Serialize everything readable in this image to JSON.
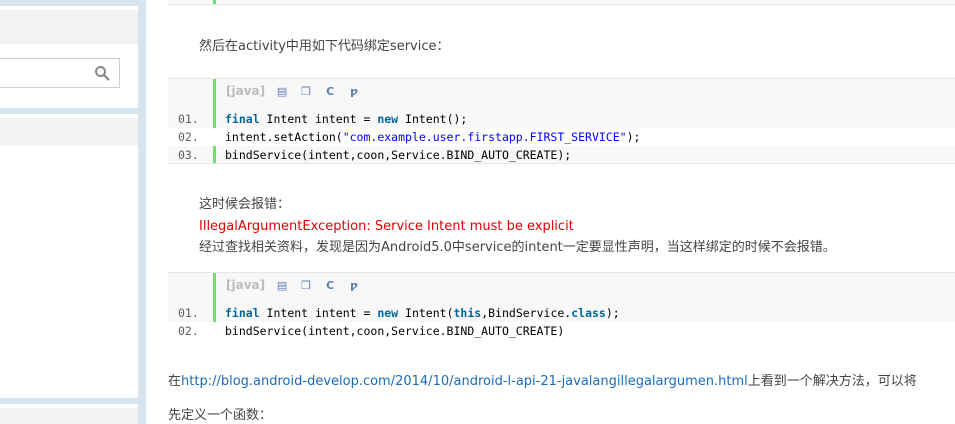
{
  "text": {
    "intro": "然后在activity中用如下代码绑定service：",
    "error_intro": "这时候会报错：",
    "error_message": "IllegalArgumentException: Service Intent must be explicit",
    "explanation": "经过查找相关资料，发现是因为Android5.0中service的intent一定要显性声明，当这样绑定的时候不会报错。",
    "link_prefix": "在",
    "link_url": "http://blog.android-develop.com/2014/10/android-l-api-21-javalangillegalargumen.html",
    "link_suffix": "上看到一个解决方法，可以将",
    "define_func": "先定义一个函数："
  },
  "code_blocks": [
    {
      "lang_label": "[java]",
      "lines": [
        {
          "num": "01.",
          "parts": [
            {
              "t": "final",
              "c": "kw"
            },
            {
              "t": " Intent intent = ",
              "c": ""
            },
            {
              "t": "new",
              "c": "kw"
            },
            {
              "t": " Intent();",
              "c": ""
            }
          ]
        },
        {
          "num": "02.",
          "parts": [
            {
              "t": "intent.setAction(",
              "c": ""
            },
            {
              "t": "\"com.example.user.firstapp.FIRST_SERVICE\"",
              "c": "str"
            },
            {
              "t": ");",
              "c": ""
            }
          ]
        },
        {
          "num": "03.",
          "parts": [
            {
              "t": "bindService(intent,coon,Service.BIND_AUTO_CREATE);",
              "c": ""
            }
          ]
        }
      ]
    },
    {
      "lang_label": "[java]",
      "lines": [
        {
          "num": "01.",
          "parts": [
            {
              "t": "final",
              "c": "kw"
            },
            {
              "t": " Intent intent = ",
              "c": ""
            },
            {
              "t": "new",
              "c": "kw"
            },
            {
              "t": " Intent(",
              "c": ""
            },
            {
              "t": "this",
              "c": "kw"
            },
            {
              "t": ",BindService.",
              "c": ""
            },
            {
              "t": "class",
              "c": "kw"
            },
            {
              "t": ");",
              "c": ""
            }
          ]
        },
        {
          "num": "02.",
          "parts": [
            {
              "t": "bindService(intent,coon,Service.BIND_AUTO_CREATE)",
              "c": ""
            }
          ]
        }
      ]
    }
  ],
  "toolbar_icons": [
    "view-source-icon",
    "copy-icon",
    "print-icon",
    "about-icon"
  ],
  "top_fragment": {
    "num": "",
    "text": "  });"
  },
  "colors": {
    "accent_bar": "#6ce26c",
    "keyword": "#006699",
    "string": "#0000ff",
    "error": "#e00000",
    "link": "#1a6bb8"
  }
}
